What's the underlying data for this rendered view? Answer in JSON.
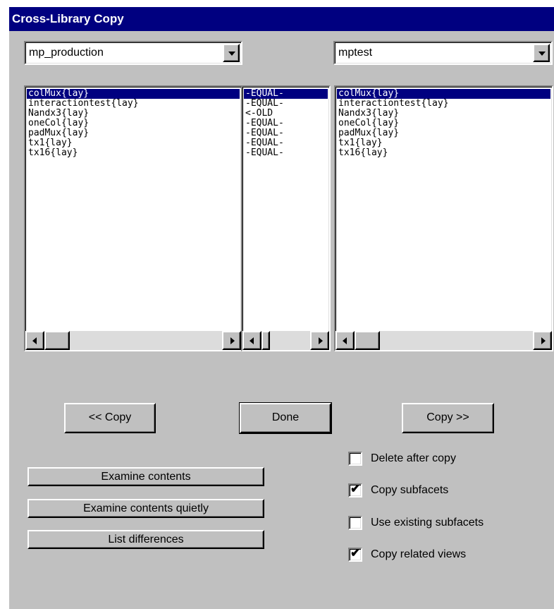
{
  "window": {
    "title": "Cross-Library Copy"
  },
  "left_library": {
    "selected": "mp_production"
  },
  "right_library": {
    "selected": "mptest"
  },
  "left_list": {
    "items": [
      "colMux{lay}",
      "interactiontest{lay}",
      "Nandx3{lay}",
      "oneCol{lay}",
      "padMux{lay}",
      "tx1{lay}",
      "tx16{lay}"
    ],
    "selected_index": 0
  },
  "compare_list": {
    "items": [
      "-EQUAL-",
      "-EQUAL-",
      "<-OLD",
      "-EQUAL-",
      "-EQUAL-",
      "-EQUAL-",
      "-EQUAL-"
    ],
    "selected_index": 0
  },
  "right_list": {
    "items": [
      "colMux{lay}",
      "interactiontest{lay}",
      "Nandx3{lay}",
      "oneCol{lay}",
      "padMux{lay}",
      "tx1{lay}",
      "tx16{lay}"
    ],
    "selected_index": 0
  },
  "buttons": {
    "copy_left": "<< Copy",
    "done": "Done",
    "copy_right": "Copy >>",
    "examine_contents": "Examine contents",
    "examine_contents_quietly": "Examine contents quietly",
    "list_differences": "List differences"
  },
  "options": [
    {
      "label": "Delete after copy",
      "checked": false
    },
    {
      "label": "Copy subfacets",
      "checked": true
    },
    {
      "label": "Use existing subfacets",
      "checked": false
    },
    {
      "label": "Copy related views",
      "checked": true
    }
  ],
  "icons": {
    "dropdown": "chevron-down-icon",
    "scroll_left": "arrow-left-icon",
    "scroll_right": "arrow-right-icon",
    "check": "checkmark-icon"
  },
  "colors": {
    "title_bar": "#000080",
    "dialog_face": "#c0c0c0",
    "selection": "#000080"
  }
}
